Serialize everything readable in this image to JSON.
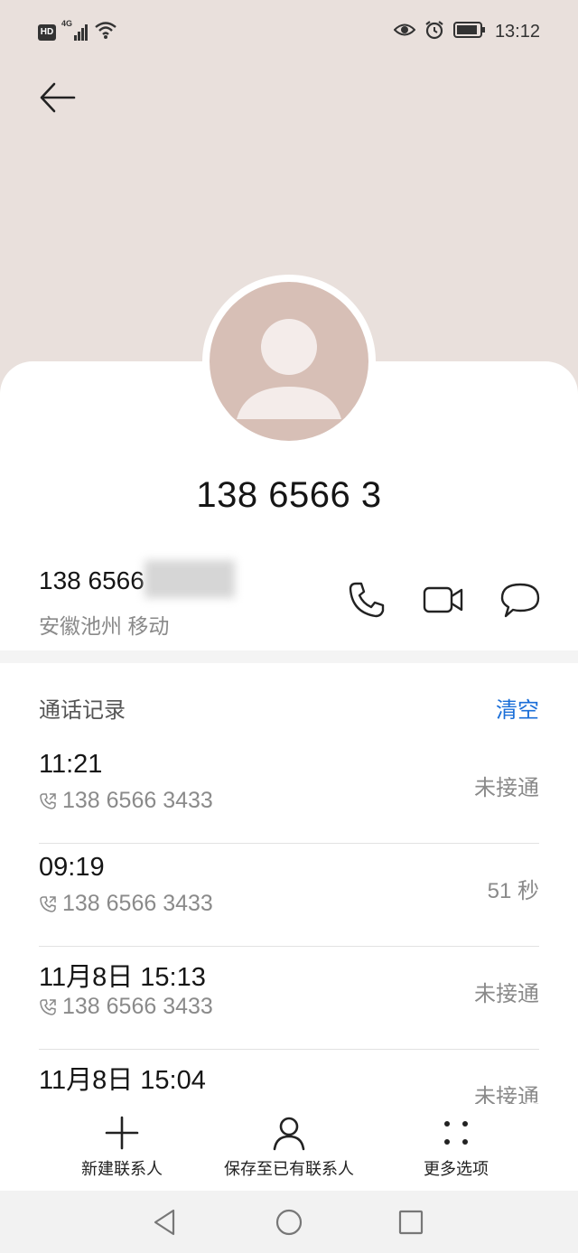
{
  "status_bar": {
    "hd_badge": "HD",
    "network_label": "4G",
    "time": "13:12"
  },
  "contact": {
    "title_number": "138 6566 3",
    "number": "138 6566",
    "location": "安徽池州 移动"
  },
  "records": {
    "title": "通话记录",
    "clear_label": "清空",
    "items": [
      {
        "time": "11:21",
        "number": "138 6566 3433",
        "status": "未接通"
      },
      {
        "time": "09:19",
        "number": "138 6566 3433",
        "status": "51 秒"
      },
      {
        "time": "11月8日 15:13",
        "number": "138 6566 3433",
        "status": "未接通"
      },
      {
        "time": "11月8日 15:04",
        "number": "",
        "status": "未接通"
      }
    ]
  },
  "toolbar": {
    "new_contact": "新建联系人",
    "save_existing": "保存至已有联系人",
    "more_options": "更多选项"
  },
  "icons": {
    "back": "arrow-left-icon",
    "phone": "phone-icon",
    "video": "video-camera-icon",
    "message": "message-bubble-icon",
    "add": "plus-icon",
    "person": "person-icon",
    "more": "four-dots-icon"
  },
  "colors": {
    "header_bg": "#e9e0dc",
    "avatar_bg": "#d7bfb6",
    "accent": "#1a6ed8"
  }
}
